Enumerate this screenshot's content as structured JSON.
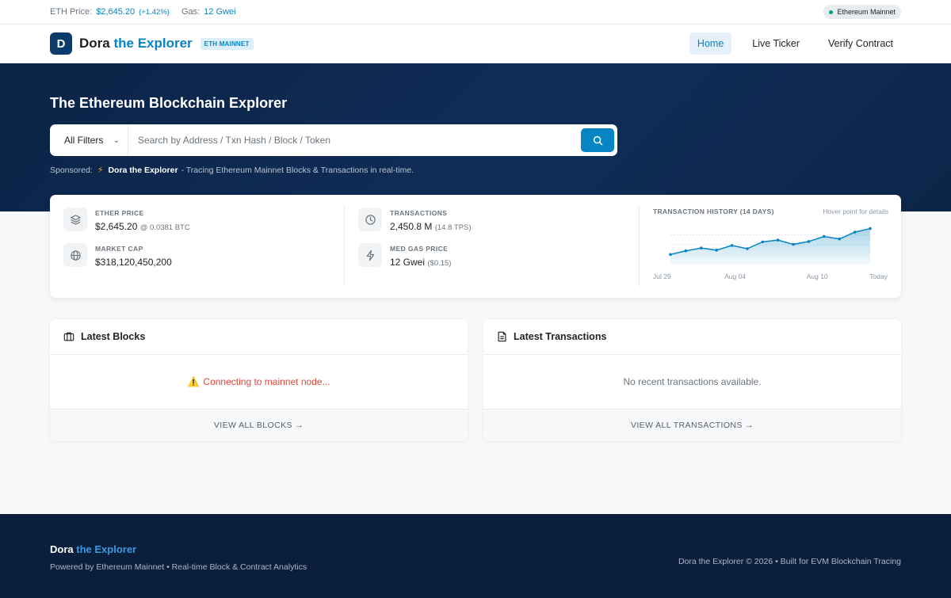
{
  "topbar": {
    "eth_price_label": "ETH Price:",
    "eth_price_value": "$2,645.20",
    "eth_price_change": "(+1.42%)",
    "gas_label": "Gas:",
    "gas_value": "12 Gwei",
    "network_pill": "Ethereum Mainnet"
  },
  "header": {
    "logo_letter": "D",
    "brand_main": "Dora",
    "brand_accent": "the Explorer",
    "network_badge": "ETH MAINNET",
    "nav": [
      "Home",
      "Live Ticker",
      "Verify Contract"
    ]
  },
  "hero": {
    "title": "The Ethereum Blockchain Explorer",
    "filter_label": "All Filters",
    "search_placeholder": "Search by Address / Txn Hash / Block / Token",
    "sponsored_label": "Sponsored:",
    "sponsored_name": "Dora the Explorer",
    "sponsored_text": "- Tracing Ethereum Mainnet Blocks & Transactions in real-time."
  },
  "stats": {
    "ether_price_label": "ETHER PRICE",
    "ether_price_value": "$2,645.20",
    "ether_price_btc": "@ 0.0381 BTC",
    "market_cap_label": "MARKET CAP",
    "market_cap_value": "$318,120,450,200",
    "transactions_label": "TRANSACTIONS",
    "transactions_value": "2,450.8 M",
    "transactions_tps": "(14.8 TPS)",
    "gas_price_label": "MED GAS PRICE",
    "gas_price_value": "12 Gwei",
    "gas_price_usd": "($0.15)"
  },
  "chart_data": {
    "type": "area",
    "title": "TRANSACTION HISTORY (14 DAYS)",
    "hint": "Hover point for details",
    "x_tick_labels": [
      "Jul 29",
      "Aug 04",
      "Aug 10",
      "Today"
    ],
    "values": [
      0.28,
      0.38,
      0.46,
      0.4,
      0.53,
      0.44,
      0.63,
      0.68,
      0.56,
      0.64,
      0.78,
      0.71,
      0.9,
      1.0
    ],
    "ylim": [
      0,
      1.1
    ]
  },
  "panels": {
    "blocks_title": "Latest Blocks",
    "blocks_status": "Connecting to mainnet node...",
    "blocks_footer": "VIEW ALL BLOCKS →",
    "txns_title": "Latest Transactions",
    "txns_status": "No recent transactions available.",
    "txns_footer": "VIEW ALL TRANSACTIONS →"
  },
  "footer": {
    "brand_main": "Dora",
    "brand_accent": "the Explorer",
    "tagline": "Powered by Ethereum Mainnet • Real-time Block & Contract Analytics",
    "copyright": "Dora the Explorer © 2026 • Built for EVM Blockchain Tracing"
  },
  "colors": {
    "accent": "#0784c3",
    "hero_bg": "#0b2447",
    "footer_bg": "#0b1e3b",
    "error": "#de4437",
    "status_dot": "#00a186"
  }
}
